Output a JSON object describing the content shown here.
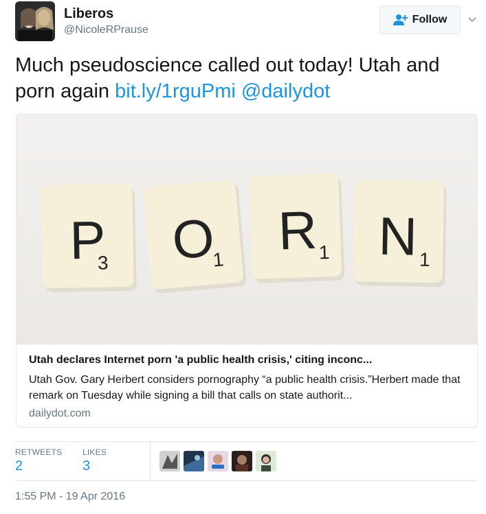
{
  "user": {
    "display_name": "Liberos",
    "handle": "@NicoleRPrause"
  },
  "follow_button": {
    "label": "Follow"
  },
  "tweet": {
    "text": "Much pseudoscience called out today! Utah and porn again",
    "link": "bit.ly/1rguPmi",
    "mention": "@dailydot"
  },
  "card": {
    "image_tiles": [
      {
        "letter": "P",
        "value": "3"
      },
      {
        "letter": "O",
        "value": "1"
      },
      {
        "letter": "R",
        "value": "1"
      },
      {
        "letter": "N",
        "value": "1"
      }
    ],
    "title": "Utah declares Internet porn 'a public health crisis,' citing inconc...",
    "description": "Utah Gov. Gary Herbert considers pornography “a public health crisis.”Herbert made that remark on Tuesday while signing a bill that calls on state authorit...",
    "domain": "dailydot.com"
  },
  "stats": {
    "retweets_label": "RETWEETS",
    "retweets_count": "2",
    "likes_label": "LIKES",
    "likes_count": "3"
  },
  "timestamp": "1:55 PM - 19 Apr 2016",
  "colors": {
    "link": "#1b95e0",
    "secondary_text": "#657786",
    "border": "#e1e8ed"
  }
}
